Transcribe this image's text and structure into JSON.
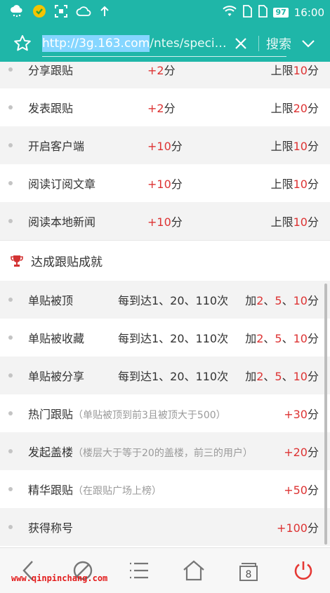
{
  "status_bar": {
    "battery": "97",
    "time": "16:00",
    "colors": {
      "bg": "#1fb6a8",
      "icon": "#ffffff"
    },
    "icons": [
      "cloud-rain-icon",
      "app-badge-icon",
      "screenshot-icon",
      "weather-cloud-icon",
      "upload-arrow-icon",
      "wifi-icon",
      "sim1-icon",
      "sim2-icon",
      "battery-icon"
    ]
  },
  "url_bar": {
    "url_highlight": "http://3g.163.com",
    "url_rest": "/ntes/speci…",
    "search_label": "搜索",
    "colors": {
      "selection": "#85d6ff"
    }
  },
  "daily_tasks": [
    {
      "label": "分享跟贴",
      "points": "+2",
      "unit": "分",
      "limit_prefix": "上限",
      "limit_num": "10",
      "limit_unit": "分"
    },
    {
      "label": "发表跟贴",
      "points": "+2",
      "unit": "分",
      "limit_prefix": "上限",
      "limit_num": "20",
      "limit_unit": "分"
    },
    {
      "label": "开启客户端",
      "points": "+10",
      "unit": "分",
      "limit_prefix": "上限",
      "limit_num": "10",
      "limit_unit": "分"
    },
    {
      "label": "阅读订阅文章",
      "points": "+10",
      "unit": "分",
      "limit_prefix": "上限",
      "limit_num": "10",
      "limit_unit": "分"
    },
    {
      "label": "阅读本地新闻",
      "points": "+10",
      "unit": "分",
      "limit_prefix": "上限",
      "limit_num": "10",
      "limit_unit": "分"
    }
  ],
  "achievement_section": {
    "title": "达成跟贴成就",
    "icon": "trophy-icon",
    "colors": {
      "icon": "#d33333"
    }
  },
  "achievements": [
    {
      "label": "单贴被顶",
      "condition": "每到达1、20、110次",
      "reward_prefix": "加",
      "r1": "2",
      "sep1": "、",
      "r2": "5",
      "sep2": "、",
      "r3": "10",
      "reward_unit": "分"
    },
    {
      "label": "单贴被收藏",
      "condition": "每到达1、20、110次",
      "reward_prefix": "加",
      "r1": "2",
      "sep1": "、",
      "r2": "5",
      "sep2": "、",
      "r3": "10",
      "reward_unit": "分"
    },
    {
      "label": "单贴被分享",
      "condition": "每到达1、20、110次",
      "reward_prefix": "加",
      "r1": "2",
      "sep1": "、",
      "r2": "5",
      "sep2": "、",
      "r3": "10",
      "reward_unit": "分"
    }
  ],
  "special": [
    {
      "label": "热门跟贴",
      "note": "（单贴被顶到前3且被顶大于500）",
      "points": "+30",
      "unit": "分"
    },
    {
      "label": "发起盖楼",
      "note": "（楼层大于等于20的盖楼，前三的用户）",
      "points": "+20",
      "unit": "分"
    },
    {
      "label": "精华跟贴",
      "note": "（在跟贴广场上榜）",
      "points": "+50",
      "unit": "分"
    },
    {
      "label": "获得称号",
      "note": "",
      "points": "+100",
      "unit": "分"
    }
  ],
  "toolbar": {
    "tabs_count": "8",
    "watermark": "www.qinpinchang.com",
    "icons": [
      "back-icon",
      "stop-icon",
      "menu-icon",
      "home-icon",
      "tabs-icon",
      "power-icon"
    ],
    "colors": {
      "power": "#e53935",
      "icon": "#777777"
    }
  },
  "colors": {
    "accent_red": "#d33333",
    "alt_row": "#f3f3f3"
  }
}
